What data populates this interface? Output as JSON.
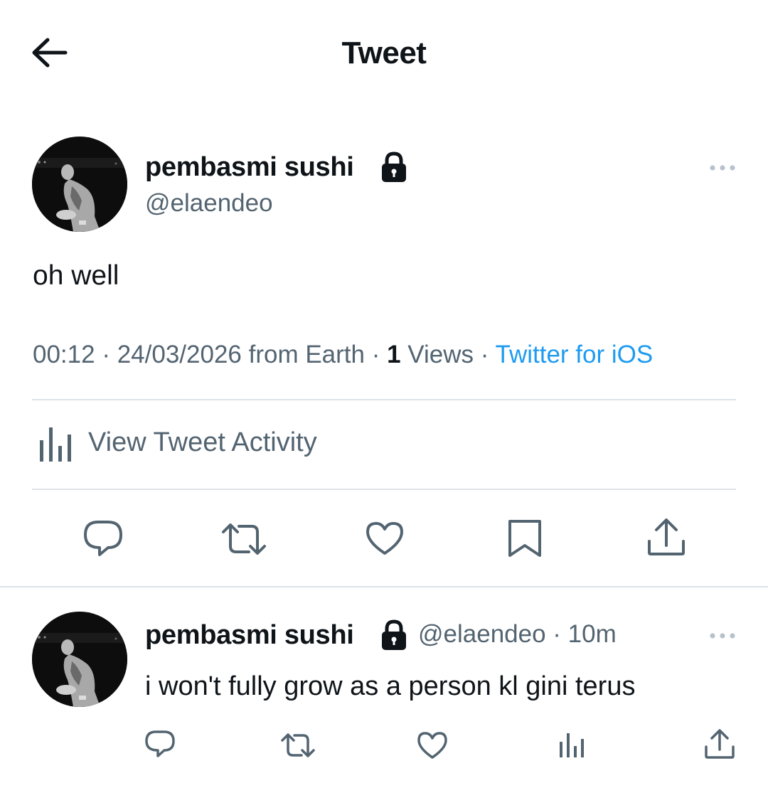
{
  "header": {
    "title": "Tweet",
    "back_icon": "arrow-left-icon"
  },
  "main_tweet": {
    "author_name": "pembasmi sushi",
    "handle": "@elaendeo",
    "protected_icon": "lock-icon",
    "more_icon": "more-horizontal-icon",
    "text": "oh well",
    "time": "00:12",
    "sep1": " · ",
    "date": "24/03/2026",
    "location": " from Earth",
    "sep2": " · ",
    "views_count": "1",
    "views_label": " Views",
    "sep3": " · ",
    "source": "Twitter for iOS",
    "activity_label": "View Tweet Activity",
    "activity_icon": "bar-chart-icon",
    "actions": [
      "reply-icon",
      "retweet-icon",
      "like-icon",
      "bookmark-icon",
      "share-icon"
    ]
  },
  "reply_tweet": {
    "author_name": "pembasmi sushi",
    "handle_time": "@elaendeo · 10m",
    "text": "i won't fully grow as a person kl gini terus",
    "more_icon": "more-horizontal-icon",
    "actions": [
      "reply-icon",
      "retweet-icon",
      "like-icon",
      "views-icon",
      "share-icon"
    ]
  },
  "colors": {
    "text_primary": "#0f1419",
    "text_secondary": "#536471",
    "accent": "#1d9bf0",
    "divider": "#dde3e7"
  }
}
